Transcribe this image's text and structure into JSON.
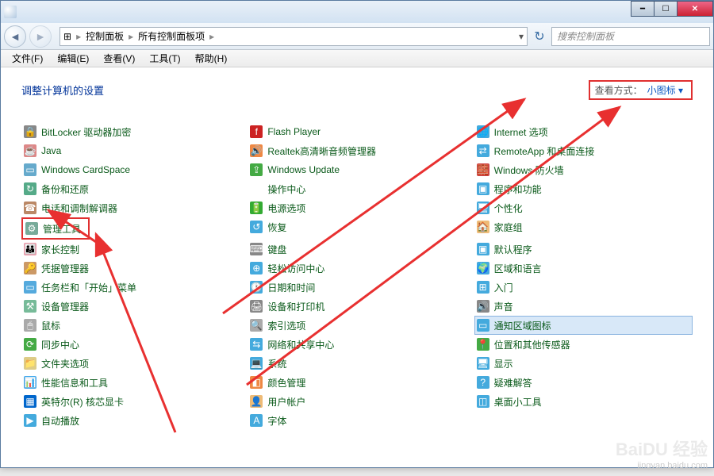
{
  "titlebar": {},
  "nav": {
    "breadcrumb": {
      "icon": "⊞",
      "sep1": "▸",
      "part1": "控制面板",
      "sep2": "▸",
      "part2": "所有控制面板项",
      "sep3": "▸"
    },
    "search_placeholder": "搜索控制面板"
  },
  "menu": {
    "file": "文件(F)",
    "edit": "编辑(E)",
    "view": "查看(V)",
    "tools": "工具(T)",
    "help": "帮助(H)"
  },
  "header": {
    "title": "调整计算机的设置",
    "view_label": "查看方式：",
    "view_value": "小图标 ▾"
  },
  "columns": {
    "c1": [
      {
        "t": "BitLocker 驱动器加密",
        "i": "🔒",
        "bg": "#888"
      },
      {
        "t": "Java",
        "i": "☕",
        "bg": "#d88"
      },
      {
        "t": "Windows CardSpace",
        "i": "▭",
        "bg": "#6ac"
      },
      {
        "t": "备份和还原",
        "i": "↻",
        "bg": "#5a8"
      },
      {
        "t": "电话和调制解调器",
        "i": "☎",
        "bg": "#b86"
      },
      {
        "t": "管理工具",
        "i": "⚙",
        "bg": "#7a9",
        "hl": true
      },
      {
        "t": "家长控制",
        "i": "👪",
        "bg": "#e9a"
      },
      {
        "t": "凭据管理器",
        "i": "🔑",
        "bg": "#c96"
      },
      {
        "t": "任务栏和「开始」菜单",
        "i": "▭",
        "bg": "#5ad"
      },
      {
        "t": "设备管理器",
        "i": "⚒",
        "bg": "#7b9"
      },
      {
        "t": "鼠标",
        "i": "🖱",
        "bg": "#aaa"
      },
      {
        "t": "同步中心",
        "i": "⟳",
        "bg": "#4a4"
      },
      {
        "t": "文件夹选项",
        "i": "📁",
        "bg": "#dc8"
      },
      {
        "t": "性能信息和工具",
        "i": "📊",
        "bg": "#4ae"
      },
      {
        "t": "英特尔(R) 核芯显卡",
        "i": "▦",
        "bg": "#06c"
      },
      {
        "t": "自动播放",
        "i": "▶",
        "bg": "#4ad"
      }
    ],
    "c2": [
      {
        "t": "Flash Player",
        "i": "f",
        "bg": "#c22"
      },
      {
        "t": "Realtek高清晰音频管理器",
        "i": "🔊",
        "bg": "#e84"
      },
      {
        "t": "Windows Update",
        "i": "⇪",
        "bg": "#4a4"
      },
      {
        "t": "操作中心",
        "i": "⚑",
        "bg": "#fff"
      },
      {
        "t": "电源选项",
        "i": "🔋",
        "bg": "#3a3"
      },
      {
        "t": "恢复",
        "i": "↺",
        "bg": "#4ad"
      },
      {
        "t": "键盘",
        "i": "⌨",
        "bg": "#888"
      },
      {
        "t": "轻松访问中心",
        "i": "⊕",
        "bg": "#4ad"
      },
      {
        "t": "日期和时间",
        "i": "🕐",
        "bg": "#4ad"
      },
      {
        "t": "设备和打印机",
        "i": "🖨",
        "bg": "#888"
      },
      {
        "t": "索引选项",
        "i": "🔍",
        "bg": "#aaa"
      },
      {
        "t": "网络和共享中心",
        "i": "⇆",
        "bg": "#4ad"
      },
      {
        "t": "系统",
        "i": "💻",
        "bg": "#4ad"
      },
      {
        "t": "颜色管理",
        "i": "◧",
        "bg": "#e84"
      },
      {
        "t": "用户帐户",
        "i": "👤",
        "bg": "#eb7"
      },
      {
        "t": "字体",
        "i": "A",
        "bg": "#4ad"
      }
    ],
    "c3": [
      {
        "t": "Internet 选项",
        "i": "🌐",
        "bg": "#4ad"
      },
      {
        "t": "RemoteApp 和桌面连接",
        "i": "⇄",
        "bg": "#4ad"
      },
      {
        "t": "Windows 防火墙",
        "i": "🧱",
        "bg": "#c44"
      },
      {
        "t": "程序和功能",
        "i": "▣",
        "bg": "#4ad"
      },
      {
        "t": "个性化",
        "i": "🖥",
        "bg": "#4ad"
      },
      {
        "t": "家庭组",
        "i": "🏠",
        "bg": "#eb7"
      },
      {
        "t": "默认程序",
        "i": "▣",
        "bg": "#4ad"
      },
      {
        "t": "区域和语言",
        "i": "🌍",
        "bg": "#4ad"
      },
      {
        "t": "入门",
        "i": "⊞",
        "bg": "#4ad"
      },
      {
        "t": "声音",
        "i": "🔊",
        "bg": "#888"
      },
      {
        "t": "通知区域图标",
        "i": "▭",
        "bg": "#4ad",
        "sel": true
      },
      {
        "t": "位置和其他传感器",
        "i": "📍",
        "bg": "#4a4"
      },
      {
        "t": "显示",
        "i": "🖥",
        "bg": "#4ad"
      },
      {
        "t": "疑难解答",
        "i": "?",
        "bg": "#4ad"
      },
      {
        "t": "桌面小工具",
        "i": "◫",
        "bg": "#4ad"
      }
    ]
  },
  "watermark": {
    "brand": "BaiDU 经验",
    "url": "jingyan.baidu.com"
  }
}
